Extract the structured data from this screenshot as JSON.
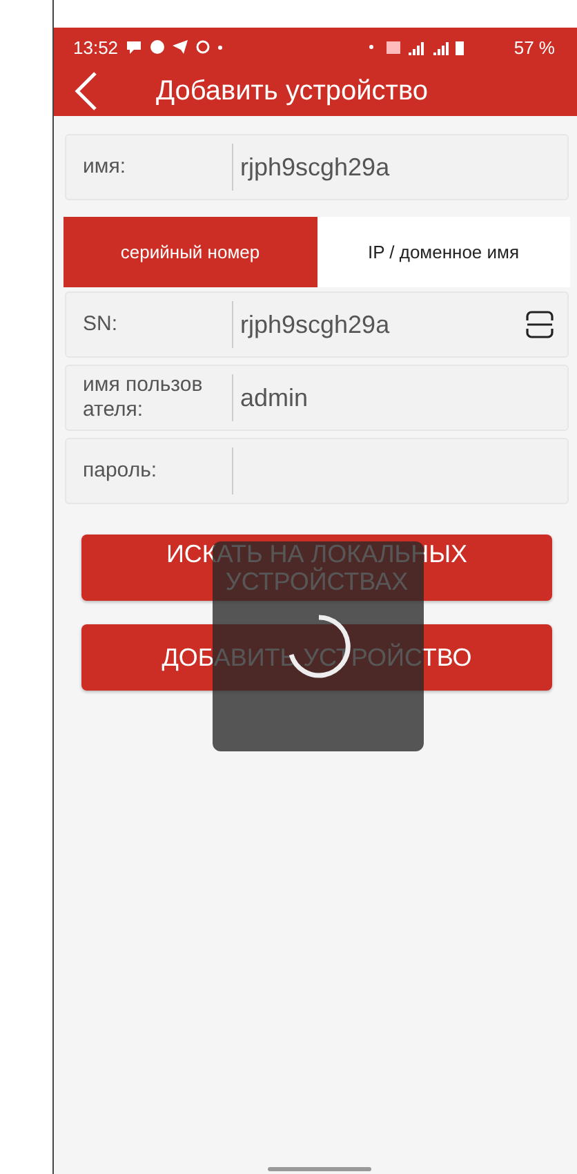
{
  "status_bar": {
    "time": "13:52",
    "battery": "57 %"
  },
  "header": {
    "title": "Добавить устройство"
  },
  "name_field": {
    "label": "имя:",
    "value": "rjph9scgh29a"
  },
  "tabs": [
    {
      "label": "серийный номер",
      "selected": true
    },
    {
      "label": "IP / доменное имя",
      "selected": false
    }
  ],
  "fields": [
    {
      "kind": "scan",
      "label": "SN:",
      "value": "rjph9scgh29a"
    },
    {
      "kind": "text",
      "label": "имя пользов ателя:",
      "value": "admin"
    },
    {
      "kind": "text",
      "label": "пароль:"
    }
  ],
  "buttons": [
    "ИСКАТЬ НА ЛОКАЛЬНЫХ УСТРОЙСТВАХ",
    "ДОБАВИТЬ УСТРОЙСТВО"
  ],
  "loading": true
}
